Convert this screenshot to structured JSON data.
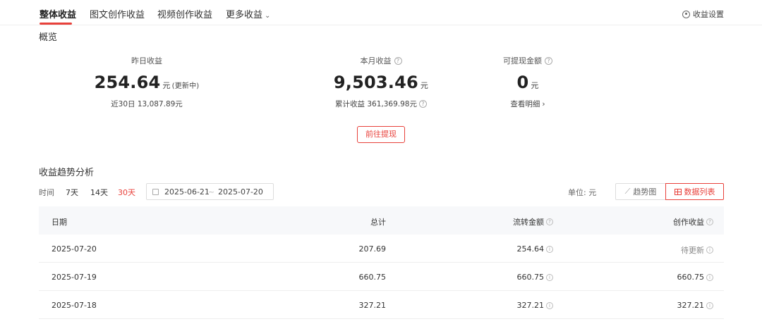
{
  "tabs": [
    {
      "label": "整体收益",
      "active": true
    },
    {
      "label": "图文创作收益",
      "active": false
    },
    {
      "label": "视频创作收益",
      "active": false
    },
    {
      "label": "更多收益",
      "active": false,
      "has_dropdown": true
    }
  ],
  "settings_label": "收益设置",
  "overview": {
    "title": "概览",
    "yesterday": {
      "label": "昨日收益",
      "value": "254.64",
      "unit": "元",
      "note": "(更新中)",
      "sub": "近30日 13,087.89元"
    },
    "month": {
      "label": "本月收益",
      "value": "9,503.46",
      "unit": "元",
      "sub": "累计收益 361,369.98元"
    },
    "withdrawable": {
      "label": "可提现金额",
      "value": "0",
      "unit": "元",
      "sub": "查看明细"
    },
    "withdraw_button": "前往提现"
  },
  "trend": {
    "title": "收益趋势分析",
    "time_label": "时间",
    "ranges": [
      {
        "label": "7天",
        "active": false
      },
      {
        "label": "14天",
        "active": false
      },
      {
        "label": "30天",
        "active": true
      }
    ],
    "date_start": "2025-06-21",
    "date_sep": "~",
    "date_end": "2025-07-20",
    "unit_label": "单位: 元",
    "view_trend": "趋势图",
    "view_list": "数据列表",
    "active_view": "数据列表"
  },
  "table": {
    "headers": {
      "date": "日期",
      "total": "总计",
      "flow": "流转金额",
      "create": "创作收益"
    },
    "rows": [
      {
        "date": "2025-07-20",
        "total": "207.69",
        "flow": "254.64",
        "create": "待更新"
      },
      {
        "date": "2025-07-19",
        "total": "660.75",
        "flow": "660.75",
        "create": "660.75"
      },
      {
        "date": "2025-07-18",
        "total": "327.21",
        "flow": "327.21",
        "create": "327.21"
      }
    ]
  },
  "colors": {
    "accent": "#e8413b",
    "header_bg": "#f7f8fa"
  },
  "icons": [
    "gear-icon",
    "help-icon",
    "calendar-icon",
    "trend-chart-icon",
    "table-grid-icon",
    "info-icon",
    "chevron-down-icon",
    "chevron-right-icon"
  ]
}
